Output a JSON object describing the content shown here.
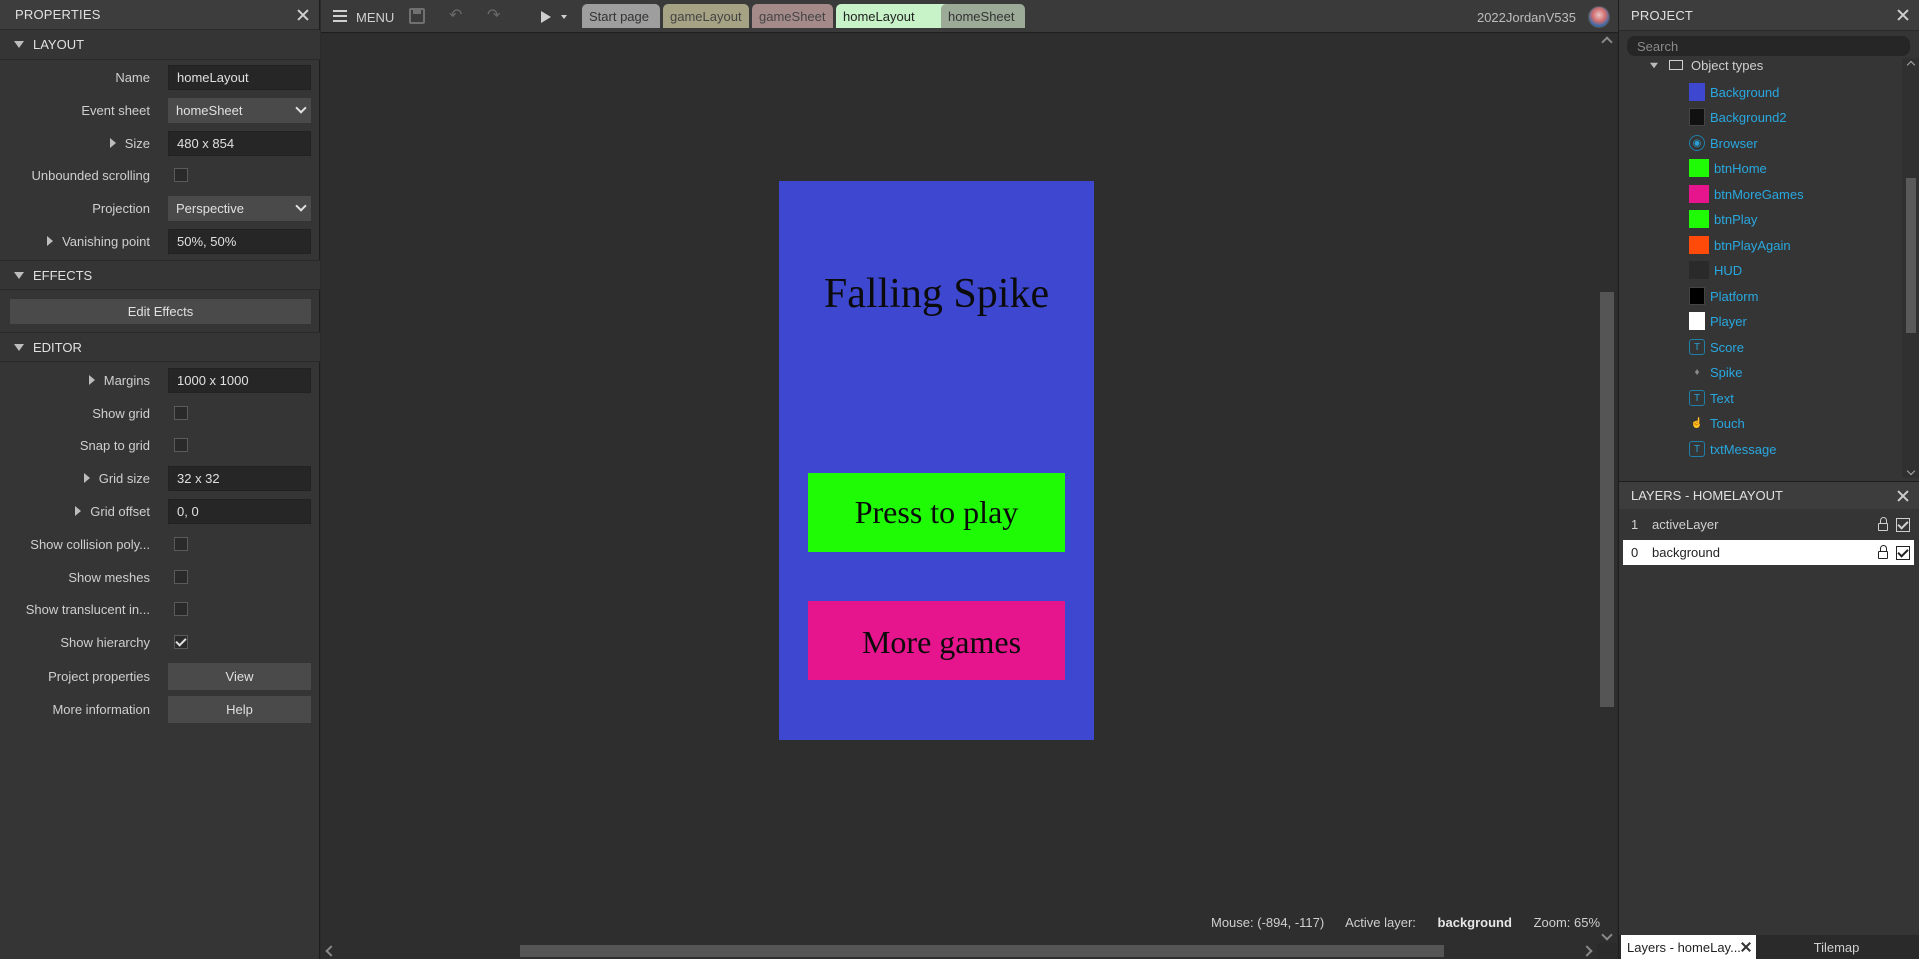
{
  "properties_panel": {
    "title": "PROPERTIES",
    "sections": {
      "layout": "LAYOUT",
      "effects": "EFFECTS",
      "editor": "EDITOR"
    },
    "name_label": "Name",
    "name_value": "homeLayout",
    "event_sheet_label": "Event sheet",
    "event_sheet_value": "homeSheet",
    "size_label": "Size",
    "size_value": "480 x 854",
    "unbounded_label": "Unbounded scrolling",
    "unbounded_checked": false,
    "projection_label": "Projection",
    "projection_value": "Perspective",
    "vanishing_label": "Vanishing point",
    "vanishing_value": "50%, 50%",
    "edit_effects_label": "Edit Effects",
    "margins_label": "Margins",
    "margins_value": "1000 x 1000",
    "show_grid_label": "Show grid",
    "show_grid_checked": false,
    "snap_grid_label": "Snap to grid",
    "snap_grid_checked": false,
    "grid_size_label": "Grid size",
    "grid_size_value": "32 x 32",
    "grid_offset_label": "Grid offset",
    "grid_offset_value": "0, 0",
    "show_collision_label": "Show collision poly...",
    "show_collision_checked": false,
    "show_meshes_label": "Show meshes",
    "show_meshes_checked": false,
    "show_translucent_label": "Show translucent in...",
    "show_translucent_checked": false,
    "show_hierarchy_label": "Show hierarchy",
    "show_hierarchy_checked": true,
    "project_props_label": "Project properties",
    "project_props_button": "View",
    "more_info_label": "More information",
    "more_info_button": "Help"
  },
  "toolbar": {
    "menu_label": "MENU",
    "tabs": [
      {
        "label": "Start page",
        "active": false
      },
      {
        "label": "gameLayout",
        "active": false
      },
      {
        "label": "gameSheet",
        "active": false
      },
      {
        "label": "homeLayout",
        "active": true
      },
      {
        "label": "homeSheet",
        "active": false
      }
    ],
    "username": "2022JordanV535"
  },
  "canvas": {
    "layout_color": "#3e47cf",
    "title_text": "Falling Spike",
    "play_button_text": "Press to play",
    "play_button_color": "#1efb05",
    "more_button_text": "More games",
    "more_button_color": "#e6148d"
  },
  "status_bar": {
    "mouse": "Mouse: (-894, -117)",
    "active_layer_label": "Active layer:",
    "active_layer_value": "background",
    "zoom": "Zoom: 65%"
  },
  "project_panel": {
    "title": "PROJECT",
    "search_placeholder": "Search",
    "folder_label": "Object types",
    "items": [
      {
        "label": "Background",
        "icon": "sprite-swatch",
        "color": "#3e47cf"
      },
      {
        "label": "Background2",
        "icon": "sprite-swatch",
        "color": "#111111"
      },
      {
        "label": "Browser",
        "icon": "globe-icon",
        "color": "#1f7fa8"
      },
      {
        "label": "btnHome",
        "icon": "sprite-swatch",
        "color": "#1efb05"
      },
      {
        "label": "btnMoreGames",
        "icon": "sprite-swatch",
        "color": "#e6148d"
      },
      {
        "label": "btnPlay",
        "icon": "sprite-swatch",
        "color": "#1efb05"
      },
      {
        "label": "btnPlayAgain",
        "icon": "sprite-swatch",
        "color": "#ff4a0a"
      },
      {
        "label": "HUD",
        "icon": "sprite-swatch",
        "color": "#2a2a2a"
      },
      {
        "label": "Platform",
        "icon": "sprite-swatch",
        "color": "#000000"
      },
      {
        "label": "Player",
        "icon": "sprite-swatch",
        "color": "#ffffff"
      },
      {
        "label": "Score",
        "icon": "text-icon",
        "color": "#1f7fa8"
      },
      {
        "label": "Spike",
        "icon": "spike-icon",
        "color": "#777777"
      },
      {
        "label": "Text",
        "icon": "text-icon",
        "color": "#1f7fa8"
      },
      {
        "label": "Touch",
        "icon": "touch-icon",
        "color": "#1f7fa8"
      },
      {
        "label": "txtMessage",
        "icon": "text-icon",
        "color": "#1f7fa8"
      }
    ]
  },
  "layers_panel": {
    "title": "LAYERS - HOMELAYOUT",
    "layers": [
      {
        "index": "1",
        "name": "activeLayer",
        "active": false
      },
      {
        "index": "0",
        "name": "background",
        "active": true
      }
    ]
  },
  "bottom_tabs": {
    "layers_tab": "Layers - homeLay...",
    "tilemap_tab": "Tilemap"
  }
}
